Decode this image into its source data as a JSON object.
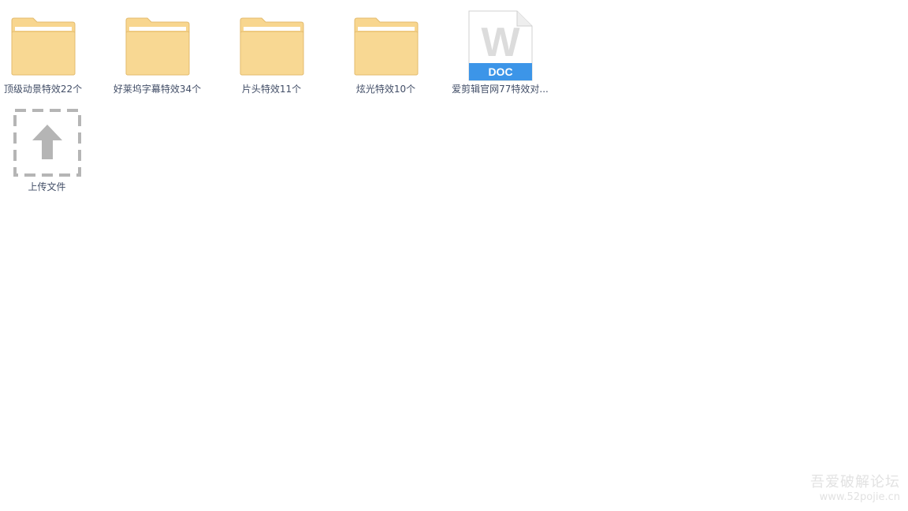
{
  "files": [
    {
      "type": "folder",
      "icon": "folder-icon",
      "name": "顶级动景特效22个"
    },
    {
      "type": "folder",
      "icon": "folder-icon",
      "name": "好莱坞字幕特效34个"
    },
    {
      "type": "folder",
      "icon": "folder-icon",
      "name": "片头特效11个"
    },
    {
      "type": "folder",
      "icon": "folder-icon",
      "name": "炫光特效10个"
    },
    {
      "type": "doc",
      "icon": "word-doc-icon",
      "badge": "DOC",
      "letter": "W",
      "name": "爱剪辑官网77特效对..."
    }
  ],
  "upload": {
    "icon": "upload-arrow-icon",
    "label": "上传文件"
  },
  "watermark": {
    "title": "吾爱破解论坛",
    "url": "www.52pojie.cn"
  },
  "colors": {
    "folder_fill": "#f8d68f",
    "folder_stroke": "#e3bb6e",
    "doc_badge": "#3c95e8",
    "label_text": "#424e67",
    "upload_dash": "#b5b5b5"
  }
}
